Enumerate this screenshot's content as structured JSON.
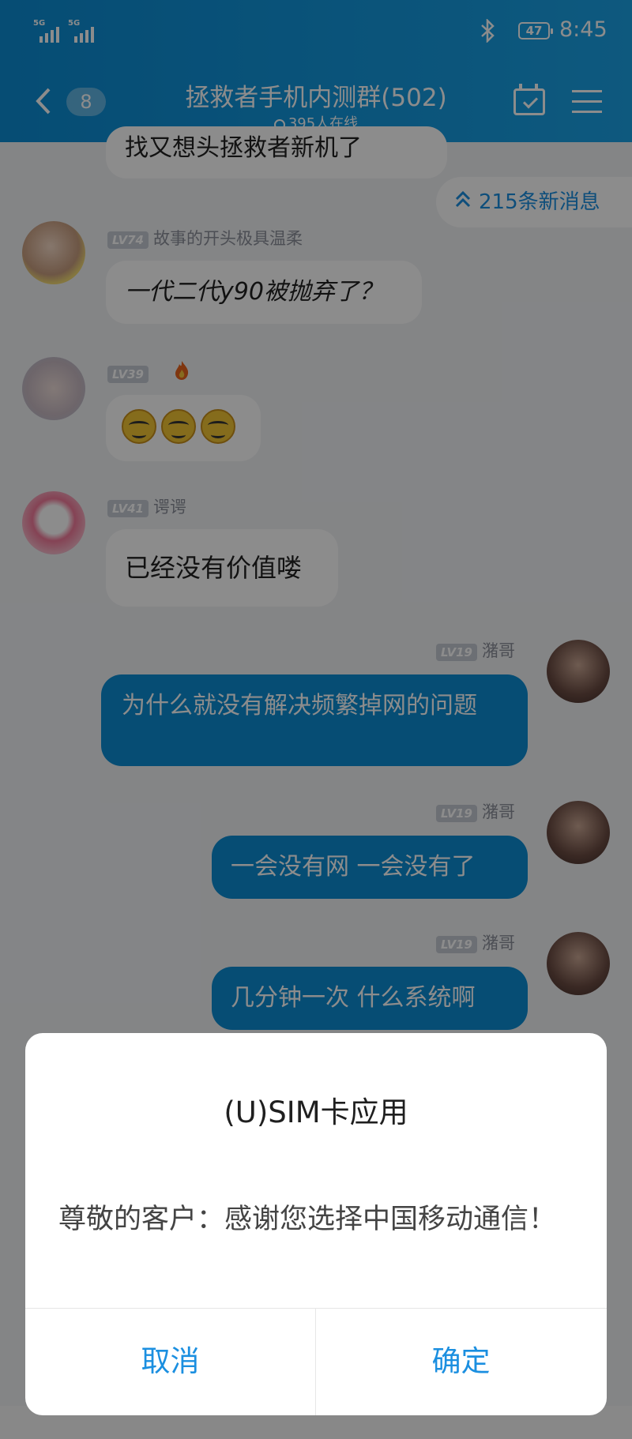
{
  "status_bar": {
    "sim1_network": "5G",
    "sim2_network": "5G",
    "battery": "47",
    "time": "8:45"
  },
  "header": {
    "back_unread_count": "8",
    "group_title": "拯救者手机内测群(502)",
    "online_count": "395人在线"
  },
  "new_messages": "215条新消息",
  "messages": [
    {
      "level": "",
      "nick": "",
      "text": "找又想头拯救者新机了"
    },
    {
      "level": "LV74",
      "nick": "故事的开头极具温柔",
      "text": "一代二代y90被抛弃了？"
    },
    {
      "level": "LV39",
      "nick": "",
      "text": ""
    },
    {
      "level": "LV41",
      "nick": "谔谔",
      "text": "已经没有价值喽"
    },
    {
      "level": "LV19",
      "nick": "潴哥",
      "text": "为什么就没有解决频繁掉网的问题"
    },
    {
      "level": "LV19",
      "nick": "潴哥",
      "text": "一会没有网  一会没有了"
    },
    {
      "level": "LV19",
      "nick": "潴哥",
      "text": "几分钟一次  什么系统啊"
    }
  ],
  "dialog": {
    "title": "(U)SIM卡应用",
    "body": "尊敬的客户：感谢您选择中国移动通信！",
    "cancel": "取消",
    "confirm": "确定"
  },
  "colors": {
    "header_bg": "#0b8cd4",
    "self_bubble": "#0b8cd4",
    "accent_text": "#1b8fe0"
  },
  "icons": [
    "signal-icon",
    "bluetooth-icon",
    "battery-icon",
    "back-icon",
    "calendar-check-icon",
    "menu-icon",
    "double-chevron-up-icon",
    "fire-icon"
  ]
}
